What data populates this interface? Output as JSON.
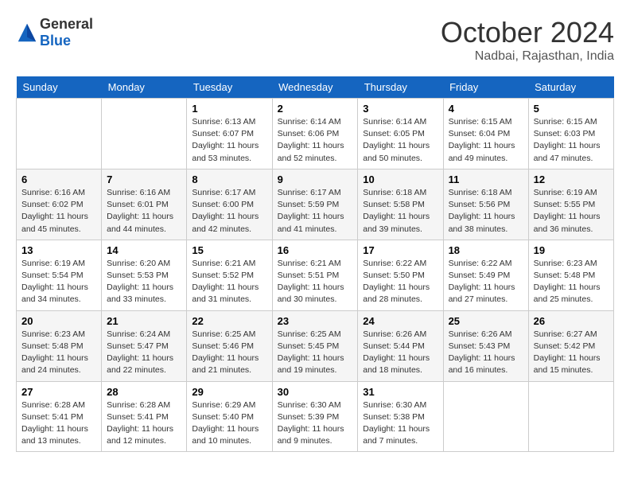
{
  "header": {
    "logo_general": "General",
    "logo_blue": "Blue",
    "month_year": "October 2024",
    "location": "Nadbai, Rajasthan, India"
  },
  "weekdays": [
    "Sunday",
    "Monday",
    "Tuesday",
    "Wednesday",
    "Thursday",
    "Friday",
    "Saturday"
  ],
  "weeks": [
    [
      {
        "day": "",
        "sunrise": "",
        "sunset": "",
        "daylight": ""
      },
      {
        "day": "",
        "sunrise": "",
        "sunset": "",
        "daylight": ""
      },
      {
        "day": "1",
        "sunrise": "Sunrise: 6:13 AM",
        "sunset": "Sunset: 6:07 PM",
        "daylight": "Daylight: 11 hours and 53 minutes."
      },
      {
        "day": "2",
        "sunrise": "Sunrise: 6:14 AM",
        "sunset": "Sunset: 6:06 PM",
        "daylight": "Daylight: 11 hours and 52 minutes."
      },
      {
        "day": "3",
        "sunrise": "Sunrise: 6:14 AM",
        "sunset": "Sunset: 6:05 PM",
        "daylight": "Daylight: 11 hours and 50 minutes."
      },
      {
        "day": "4",
        "sunrise": "Sunrise: 6:15 AM",
        "sunset": "Sunset: 6:04 PM",
        "daylight": "Daylight: 11 hours and 49 minutes."
      },
      {
        "day": "5",
        "sunrise": "Sunrise: 6:15 AM",
        "sunset": "Sunset: 6:03 PM",
        "daylight": "Daylight: 11 hours and 47 minutes."
      }
    ],
    [
      {
        "day": "6",
        "sunrise": "Sunrise: 6:16 AM",
        "sunset": "Sunset: 6:02 PM",
        "daylight": "Daylight: 11 hours and 45 minutes."
      },
      {
        "day": "7",
        "sunrise": "Sunrise: 6:16 AM",
        "sunset": "Sunset: 6:01 PM",
        "daylight": "Daylight: 11 hours and 44 minutes."
      },
      {
        "day": "8",
        "sunrise": "Sunrise: 6:17 AM",
        "sunset": "Sunset: 6:00 PM",
        "daylight": "Daylight: 11 hours and 42 minutes."
      },
      {
        "day": "9",
        "sunrise": "Sunrise: 6:17 AM",
        "sunset": "Sunset: 5:59 PM",
        "daylight": "Daylight: 11 hours and 41 minutes."
      },
      {
        "day": "10",
        "sunrise": "Sunrise: 6:18 AM",
        "sunset": "Sunset: 5:58 PM",
        "daylight": "Daylight: 11 hours and 39 minutes."
      },
      {
        "day": "11",
        "sunrise": "Sunrise: 6:18 AM",
        "sunset": "Sunset: 5:56 PM",
        "daylight": "Daylight: 11 hours and 38 minutes."
      },
      {
        "day": "12",
        "sunrise": "Sunrise: 6:19 AM",
        "sunset": "Sunset: 5:55 PM",
        "daylight": "Daylight: 11 hours and 36 minutes."
      }
    ],
    [
      {
        "day": "13",
        "sunrise": "Sunrise: 6:19 AM",
        "sunset": "Sunset: 5:54 PM",
        "daylight": "Daylight: 11 hours and 34 minutes."
      },
      {
        "day": "14",
        "sunrise": "Sunrise: 6:20 AM",
        "sunset": "Sunset: 5:53 PM",
        "daylight": "Daylight: 11 hours and 33 minutes."
      },
      {
        "day": "15",
        "sunrise": "Sunrise: 6:21 AM",
        "sunset": "Sunset: 5:52 PM",
        "daylight": "Daylight: 11 hours and 31 minutes."
      },
      {
        "day": "16",
        "sunrise": "Sunrise: 6:21 AM",
        "sunset": "Sunset: 5:51 PM",
        "daylight": "Daylight: 11 hours and 30 minutes."
      },
      {
        "day": "17",
        "sunrise": "Sunrise: 6:22 AM",
        "sunset": "Sunset: 5:50 PM",
        "daylight": "Daylight: 11 hours and 28 minutes."
      },
      {
        "day": "18",
        "sunrise": "Sunrise: 6:22 AM",
        "sunset": "Sunset: 5:49 PM",
        "daylight": "Daylight: 11 hours and 27 minutes."
      },
      {
        "day": "19",
        "sunrise": "Sunrise: 6:23 AM",
        "sunset": "Sunset: 5:48 PM",
        "daylight": "Daylight: 11 hours and 25 minutes."
      }
    ],
    [
      {
        "day": "20",
        "sunrise": "Sunrise: 6:23 AM",
        "sunset": "Sunset: 5:48 PM",
        "daylight": "Daylight: 11 hours and 24 minutes."
      },
      {
        "day": "21",
        "sunrise": "Sunrise: 6:24 AM",
        "sunset": "Sunset: 5:47 PM",
        "daylight": "Daylight: 11 hours and 22 minutes."
      },
      {
        "day": "22",
        "sunrise": "Sunrise: 6:25 AM",
        "sunset": "Sunset: 5:46 PM",
        "daylight": "Daylight: 11 hours and 21 minutes."
      },
      {
        "day": "23",
        "sunrise": "Sunrise: 6:25 AM",
        "sunset": "Sunset: 5:45 PM",
        "daylight": "Daylight: 11 hours and 19 minutes."
      },
      {
        "day": "24",
        "sunrise": "Sunrise: 6:26 AM",
        "sunset": "Sunset: 5:44 PM",
        "daylight": "Daylight: 11 hours and 18 minutes."
      },
      {
        "day": "25",
        "sunrise": "Sunrise: 6:26 AM",
        "sunset": "Sunset: 5:43 PM",
        "daylight": "Daylight: 11 hours and 16 minutes."
      },
      {
        "day": "26",
        "sunrise": "Sunrise: 6:27 AM",
        "sunset": "Sunset: 5:42 PM",
        "daylight": "Daylight: 11 hours and 15 minutes."
      }
    ],
    [
      {
        "day": "27",
        "sunrise": "Sunrise: 6:28 AM",
        "sunset": "Sunset: 5:41 PM",
        "daylight": "Daylight: 11 hours and 13 minutes."
      },
      {
        "day": "28",
        "sunrise": "Sunrise: 6:28 AM",
        "sunset": "Sunset: 5:41 PM",
        "daylight": "Daylight: 11 hours and 12 minutes."
      },
      {
        "day": "29",
        "sunrise": "Sunrise: 6:29 AM",
        "sunset": "Sunset: 5:40 PM",
        "daylight": "Daylight: 11 hours and 10 minutes."
      },
      {
        "day": "30",
        "sunrise": "Sunrise: 6:30 AM",
        "sunset": "Sunset: 5:39 PM",
        "daylight": "Daylight: 11 hours and 9 minutes."
      },
      {
        "day": "31",
        "sunrise": "Sunrise: 6:30 AM",
        "sunset": "Sunset: 5:38 PM",
        "daylight": "Daylight: 11 hours and 7 minutes."
      },
      {
        "day": "",
        "sunrise": "",
        "sunset": "",
        "daylight": ""
      },
      {
        "day": "",
        "sunrise": "",
        "sunset": "",
        "daylight": ""
      }
    ]
  ]
}
